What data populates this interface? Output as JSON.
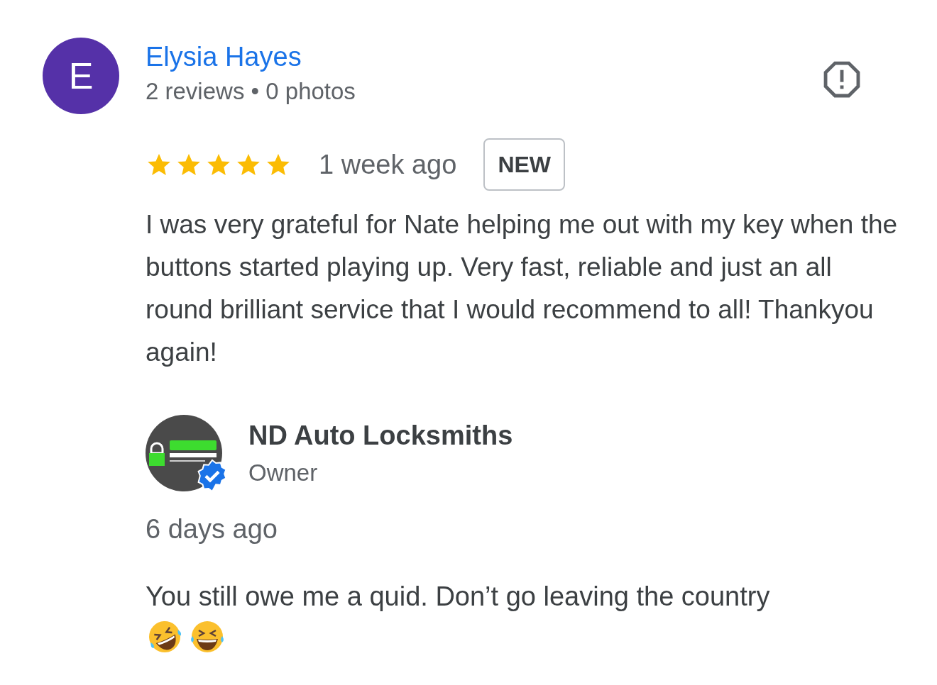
{
  "review": {
    "avatar_letter": "E",
    "author": "Elysia Hayes",
    "author_stats": "2 reviews • 0 photos",
    "stars": 5,
    "time": "1 week ago",
    "badge": "NEW",
    "text": "I was very grateful for Nate helping me out with my key when the buttons started playing up. Very fast, reliable and just an all round brilliant service that I would recommend to all! Thankyou again!"
  },
  "owner_reply": {
    "avatar": {
      "kind": "picture",
      "verified": true
    },
    "name": "ND Auto Locksmiths",
    "role": "Owner",
    "time": "6 days ago",
    "text": "You still owe me a quid. Don’t go leaving the country"
  }
}
